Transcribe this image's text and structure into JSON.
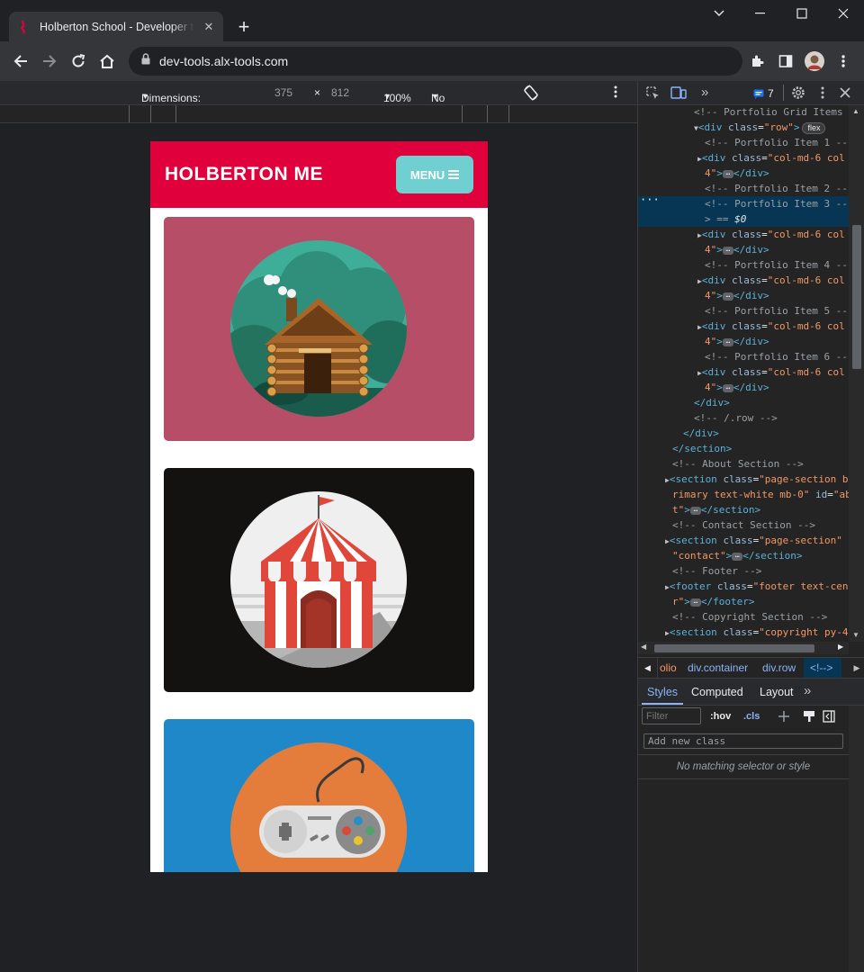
{
  "browser": {
    "tab_title": "Holberton School - Developer tools",
    "url": "dev-tools.alx-tools.com",
    "new_tab_glyph": "+",
    "close_glyph": "✕"
  },
  "device_toolbar": {
    "dimensions_label": "Dimensions: iPhone X",
    "width": "375",
    "times": "×",
    "height": "812",
    "zoom": "100%",
    "throttling": "No throttling"
  },
  "page": {
    "brand": "HOLBERTON ME",
    "menu_label": "MENU",
    "colors": {
      "navbar": "#e0003c",
      "menu_button": "#6fcfd1",
      "card1": "#b74e67",
      "card2": "#141111",
      "card3": "#1e88c8"
    }
  },
  "devtools": {
    "issues_count": "7",
    "lines": [
      {
        "indent": 62,
        "html": "<span class='cmt'>&lt;!-- Portfolio Grid Items</span>"
      },
      {
        "indent": 62,
        "html": "<span class='tri'>▼</span><span class='tag'>&lt;div</span> <span class='attr'>class</span>=<span class='aval'>\"row\"</span><span class='tag'>&gt;</span>"
      },
      {
        "indent": 74,
        "html": "<span class='cmt'>&lt;!-- Portfolio Item 1 --</span>"
      },
      {
        "indent": 66,
        "html": "<span class='tri'>▶</span><span class='tag'>&lt;div</span> <span class='attr'>class</span>=<span class='aval'>\"col-md-6 col</span>"
      },
      {
        "indent": 74,
        "html": "<span class='aval'>4\"</span><span class='tag'>&gt;</span><span class='ellip'>…</span><span class='tag'>&lt;/div&gt;</span>"
      },
      {
        "indent": 74,
        "html": "<span class='cmt'>&lt;!-- Portfolio Item 2 --</span>"
      },
      {
        "indent": 74,
        "html": "<span class='cmt'>&lt;!-- Portfolio Item 3 --</span>"
      },
      {
        "indent": 74,
        "html": "<span class='cmt'>&gt; == </span><span style='color:#e8eaed;font-style:italic'>$0</span>"
      },
      {
        "indent": 66,
        "html": "<span class='tri'>▶</span><span class='tag'>&lt;div</span> <span class='attr'>class</span>=<span class='aval'>\"col-md-6 col</span>"
      },
      {
        "indent": 74,
        "html": "<span class='aval'>4\"</span><span class='tag'>&gt;</span><span class='ellip'>…</span><span class='tag'>&lt;/div&gt;</span>"
      },
      {
        "indent": 74,
        "html": "<span class='cmt'>&lt;!-- Portfolio Item 4 --</span>"
      },
      {
        "indent": 66,
        "html": "<span class='tri'>▶</span><span class='tag'>&lt;div</span> <span class='attr'>class</span>=<span class='aval'>\"col-md-6 col</span>"
      },
      {
        "indent": 74,
        "html": "<span class='aval'>4\"</span><span class='tag'>&gt;</span><span class='ellip'>…</span><span class='tag'>&lt;/div&gt;</span>"
      },
      {
        "indent": 74,
        "html": "<span class='cmt'>&lt;!-- Portfolio Item 5 --</span>"
      },
      {
        "indent": 66,
        "html": "<span class='tri'>▶</span><span class='tag'>&lt;div</span> <span class='attr'>class</span>=<span class='aval'>\"col-md-6 col</span>"
      },
      {
        "indent": 74,
        "html": "<span class='aval'>4\"</span><span class='tag'>&gt;</span><span class='ellip'>…</span><span class='tag'>&lt;/div&gt;</span>"
      },
      {
        "indent": 74,
        "html": "<span class='cmt'>&lt;!-- Portfolio Item 6 --</span>"
      },
      {
        "indent": 66,
        "html": "<span class='tri'>▶</span><span class='tag'>&lt;div</span> <span class='attr'>class</span>=<span class='aval'>\"col-md-6 col</span>"
      },
      {
        "indent": 74,
        "html": "<span class='aval'>4\"</span><span class='tag'>&gt;</span><span class='ellip'>…</span><span class='tag'>&lt;/div&gt;</span>"
      },
      {
        "indent": 62,
        "html": "<span class='tag'>&lt;/div&gt;</span>"
      },
      {
        "indent": 62,
        "html": "<span class='cmt'>&lt;!-- /.row --&gt;</span>"
      },
      {
        "indent": 50,
        "html": "<span class='tag'>&lt;/div&gt;</span>"
      },
      {
        "indent": 38,
        "html": "<span class='tag'>&lt;/section&gt;</span>"
      },
      {
        "indent": 38,
        "html": "<span class='cmt'>&lt;!-- About Section --&gt;</span>"
      },
      {
        "indent": 30,
        "html": "<span class='tri'>▶</span><span class='tag'>&lt;section</span> <span class='attr'>class</span>=<span class='aval'>\"page-section b</span>"
      },
      {
        "indent": 38,
        "html": "<span class='aval'>rimary text-white mb-0\"</span> <span class='attr'>id</span>=<span class='aval'>\"ab</span>"
      },
      {
        "indent": 38,
        "html": "<span class='aval'>t\"</span><span class='tag'>&gt;</span><span class='ellip'>…</span><span class='tag'>&lt;/section&gt;</span>"
      },
      {
        "indent": 38,
        "html": "<span class='cmt'>&lt;!-- Contact Section --&gt;</span>"
      },
      {
        "indent": 30,
        "html": "<span class='tri'>▶</span><span class='tag'>&lt;section</span> <span class='attr'>class</span>=<span class='aval'>\"page-section\"</span>"
      },
      {
        "indent": 38,
        "html": "<span class='aval'>\"contact\"</span><span class='tag'>&gt;</span><span class='ellip'>…</span><span class='tag'>&lt;/section&gt;</span>"
      },
      {
        "indent": 38,
        "html": "<span class='cmt'>&lt;!-- Footer --&gt;</span>"
      },
      {
        "indent": 30,
        "html": "<span class='tri'>▶</span><span class='tag'>&lt;footer</span> <span class='attr'>class</span>=<span class='aval'>\"footer text-cen</span>"
      },
      {
        "indent": 38,
        "html": "<span class='aval'>r\"</span><span class='tag'>&gt;</span><span class='ellip'>…</span><span class='tag'>&lt;/footer&gt;</span>"
      },
      {
        "indent": 38,
        "html": "<span class='cmt'>&lt;!-- Copyright Section --&gt;</span>"
      },
      {
        "indent": 30,
        "html": "<span class='tri'>▶</span><span class='tag'>&lt;section</span> <span class='attr'>class</span>=<span class='aval'>\"copyright py-4</span>"
      }
    ],
    "flex_badge": "flex",
    "breadcrumbs": [
      "olio",
      "div.container",
      "div.row",
      "<!-->"
    ],
    "panel_tabs": [
      "Styles",
      "Computed",
      "Layout"
    ],
    "filter_placeholder": "Filter",
    "hov_label": ":hov",
    "cls_label": ".cls",
    "add_class_placeholder": "Add new class",
    "no_match_text": "No matching selector or style"
  }
}
